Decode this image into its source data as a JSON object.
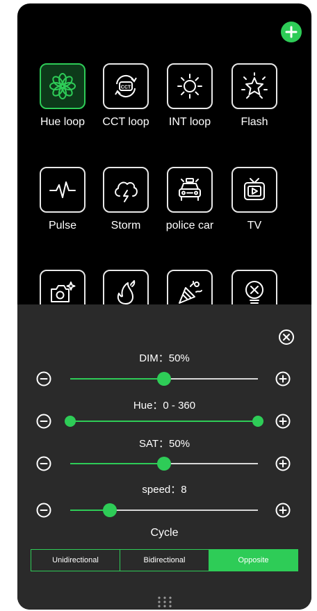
{
  "header": {
    "add_button_icon": "plus-icon"
  },
  "effects": [
    {
      "label": "Hue loop",
      "icon": "flower-icon",
      "active": true
    },
    {
      "label": "CCT loop",
      "icon": "cct-cycle-icon",
      "active": false
    },
    {
      "label": "INT loop",
      "icon": "sun-icon",
      "active": false
    },
    {
      "label": "Flash",
      "icon": "sparkle-star-icon",
      "active": false
    },
    {
      "label": "Pulse",
      "icon": "heartbeat-icon",
      "active": false
    },
    {
      "label": "Storm",
      "icon": "storm-cloud-icon",
      "active": false
    },
    {
      "label": "police car",
      "icon": "police-car-icon",
      "active": false
    },
    {
      "label": "TV",
      "icon": "tv-icon",
      "active": false
    },
    {
      "label": "",
      "icon": "camera-sparkle-icon",
      "active": false
    },
    {
      "label": "",
      "icon": "fire-icon",
      "active": false
    },
    {
      "label": "",
      "icon": "party-popper-icon",
      "active": false
    },
    {
      "label": "",
      "icon": "broken-bulb-icon",
      "active": false
    }
  ],
  "panel": {
    "sliders": [
      {
        "id": "dim",
        "label": "DIM：50%",
        "from": 0.5,
        "to": null
      },
      {
        "id": "hue",
        "label": "Hue：0 - 360",
        "from": 0.0,
        "to": 1.0
      },
      {
        "id": "sat",
        "label": "SAT：50%",
        "from": 0.5,
        "to": null
      },
      {
        "id": "speed",
        "label": "speed：8",
        "from": 0.21,
        "to": null
      }
    ],
    "cycle_title": "Cycle",
    "cycle_options": [
      {
        "label": "Unidirectional",
        "active": false
      },
      {
        "label": "Bidirectional",
        "active": false
      },
      {
        "label": "Opposite",
        "active": true
      }
    ]
  },
  "colors": {
    "accent": "#2ecc57",
    "background": "#000000",
    "panel": "#2a2a2a",
    "track": "#d8d8d8",
    "text": "#ffffff"
  }
}
